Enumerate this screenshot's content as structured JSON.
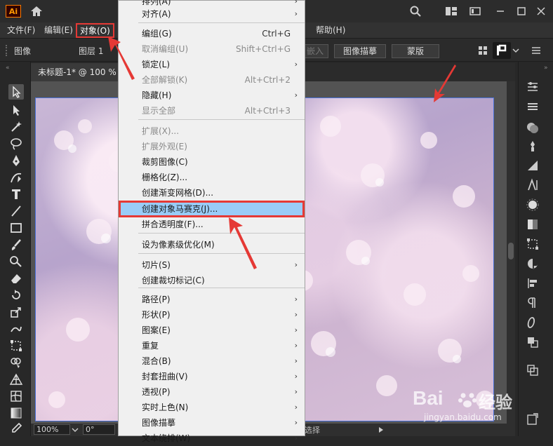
{
  "app": {
    "logo_text": "Ai"
  },
  "menubar": {
    "items": [
      "文件(F)",
      "编辑(E)",
      "对象(O)",
      "帮助(H)"
    ]
  },
  "controlbar": {
    "object_label": "图像",
    "layer_label": "图层 1",
    "embed_label": "嵌入",
    "trace_button": "图像描摹",
    "mask_button": "蒙版"
  },
  "document": {
    "tab_title": "未标题-1* @ 100 %"
  },
  "statusbar": {
    "zoom": "100%",
    "rotation": "0°",
    "mode": "选择"
  },
  "dropdown": {
    "items": [
      {
        "label": "排列(A)",
        "shortcut": "",
        "submenu": true,
        "disabled": false
      },
      {
        "label": "对齐(A)",
        "shortcut": "",
        "submenu": true,
        "disabled": false
      },
      {
        "label": "编组(G)",
        "shortcut": "Ctrl+G",
        "submenu": false,
        "disabled": false
      },
      {
        "label": "取消编组(U)",
        "shortcut": "Shift+Ctrl+G",
        "submenu": false,
        "disabled": true
      },
      {
        "label": "锁定(L)",
        "shortcut": "",
        "submenu": true,
        "disabled": false
      },
      {
        "label": "全部解锁(K)",
        "shortcut": "Alt+Ctrl+2",
        "submenu": false,
        "disabled": true
      },
      {
        "label": "隐藏(H)",
        "shortcut": "",
        "submenu": true,
        "disabled": false
      },
      {
        "label": "显示全部",
        "shortcut": "Alt+Ctrl+3",
        "submenu": false,
        "disabled": true
      },
      {
        "label": "扩展(X)...",
        "shortcut": "",
        "submenu": false,
        "disabled": true
      },
      {
        "label": "扩展外观(E)",
        "shortcut": "",
        "submenu": false,
        "disabled": true
      },
      {
        "label": "裁剪图像(C)",
        "shortcut": "",
        "submenu": false,
        "disabled": false
      },
      {
        "label": "栅格化(Z)...",
        "shortcut": "",
        "submenu": false,
        "disabled": false
      },
      {
        "label": "创建渐变网格(D)...",
        "shortcut": "",
        "submenu": false,
        "disabled": false
      },
      {
        "label": "创建对象马赛克(J)...",
        "shortcut": "",
        "submenu": false,
        "disabled": false
      },
      {
        "label": "拼合透明度(F)...",
        "shortcut": "",
        "submenu": false,
        "disabled": false
      },
      {
        "label": "设为像素级优化(M)",
        "shortcut": "",
        "submenu": false,
        "disabled": false
      },
      {
        "label": "切片(S)",
        "shortcut": "",
        "submenu": true,
        "disabled": false
      },
      {
        "label": "创建裁切标记(C)",
        "shortcut": "",
        "submenu": false,
        "disabled": false
      },
      {
        "label": "路径(P)",
        "shortcut": "",
        "submenu": true,
        "disabled": false
      },
      {
        "label": "形状(P)",
        "shortcut": "",
        "submenu": true,
        "disabled": false
      },
      {
        "label": "图案(E)",
        "shortcut": "",
        "submenu": true,
        "disabled": false
      },
      {
        "label": "重复",
        "shortcut": "",
        "submenu": true,
        "disabled": false
      },
      {
        "label": "混合(B)",
        "shortcut": "",
        "submenu": true,
        "disabled": false
      },
      {
        "label": "封套扭曲(V)",
        "shortcut": "",
        "submenu": true,
        "disabled": false
      },
      {
        "label": "透视(P)",
        "shortcut": "",
        "submenu": true,
        "disabled": false
      },
      {
        "label": "实时上色(N)",
        "shortcut": "",
        "submenu": true,
        "disabled": false
      },
      {
        "label": "图像描摹",
        "shortcut": "",
        "submenu": true,
        "disabled": false
      },
      {
        "label": "文本绕排(W)",
        "shortcut": "",
        "submenu": true,
        "disabled": false
      }
    ]
  },
  "watermark": {
    "brand": "Bai",
    "brand2": "经验",
    "url": "jingyan.baidu.com"
  },
  "colors": {
    "highlight": "#99ccf7",
    "annotation_red": "#e53935",
    "selection_blue": "#4a72d8"
  }
}
